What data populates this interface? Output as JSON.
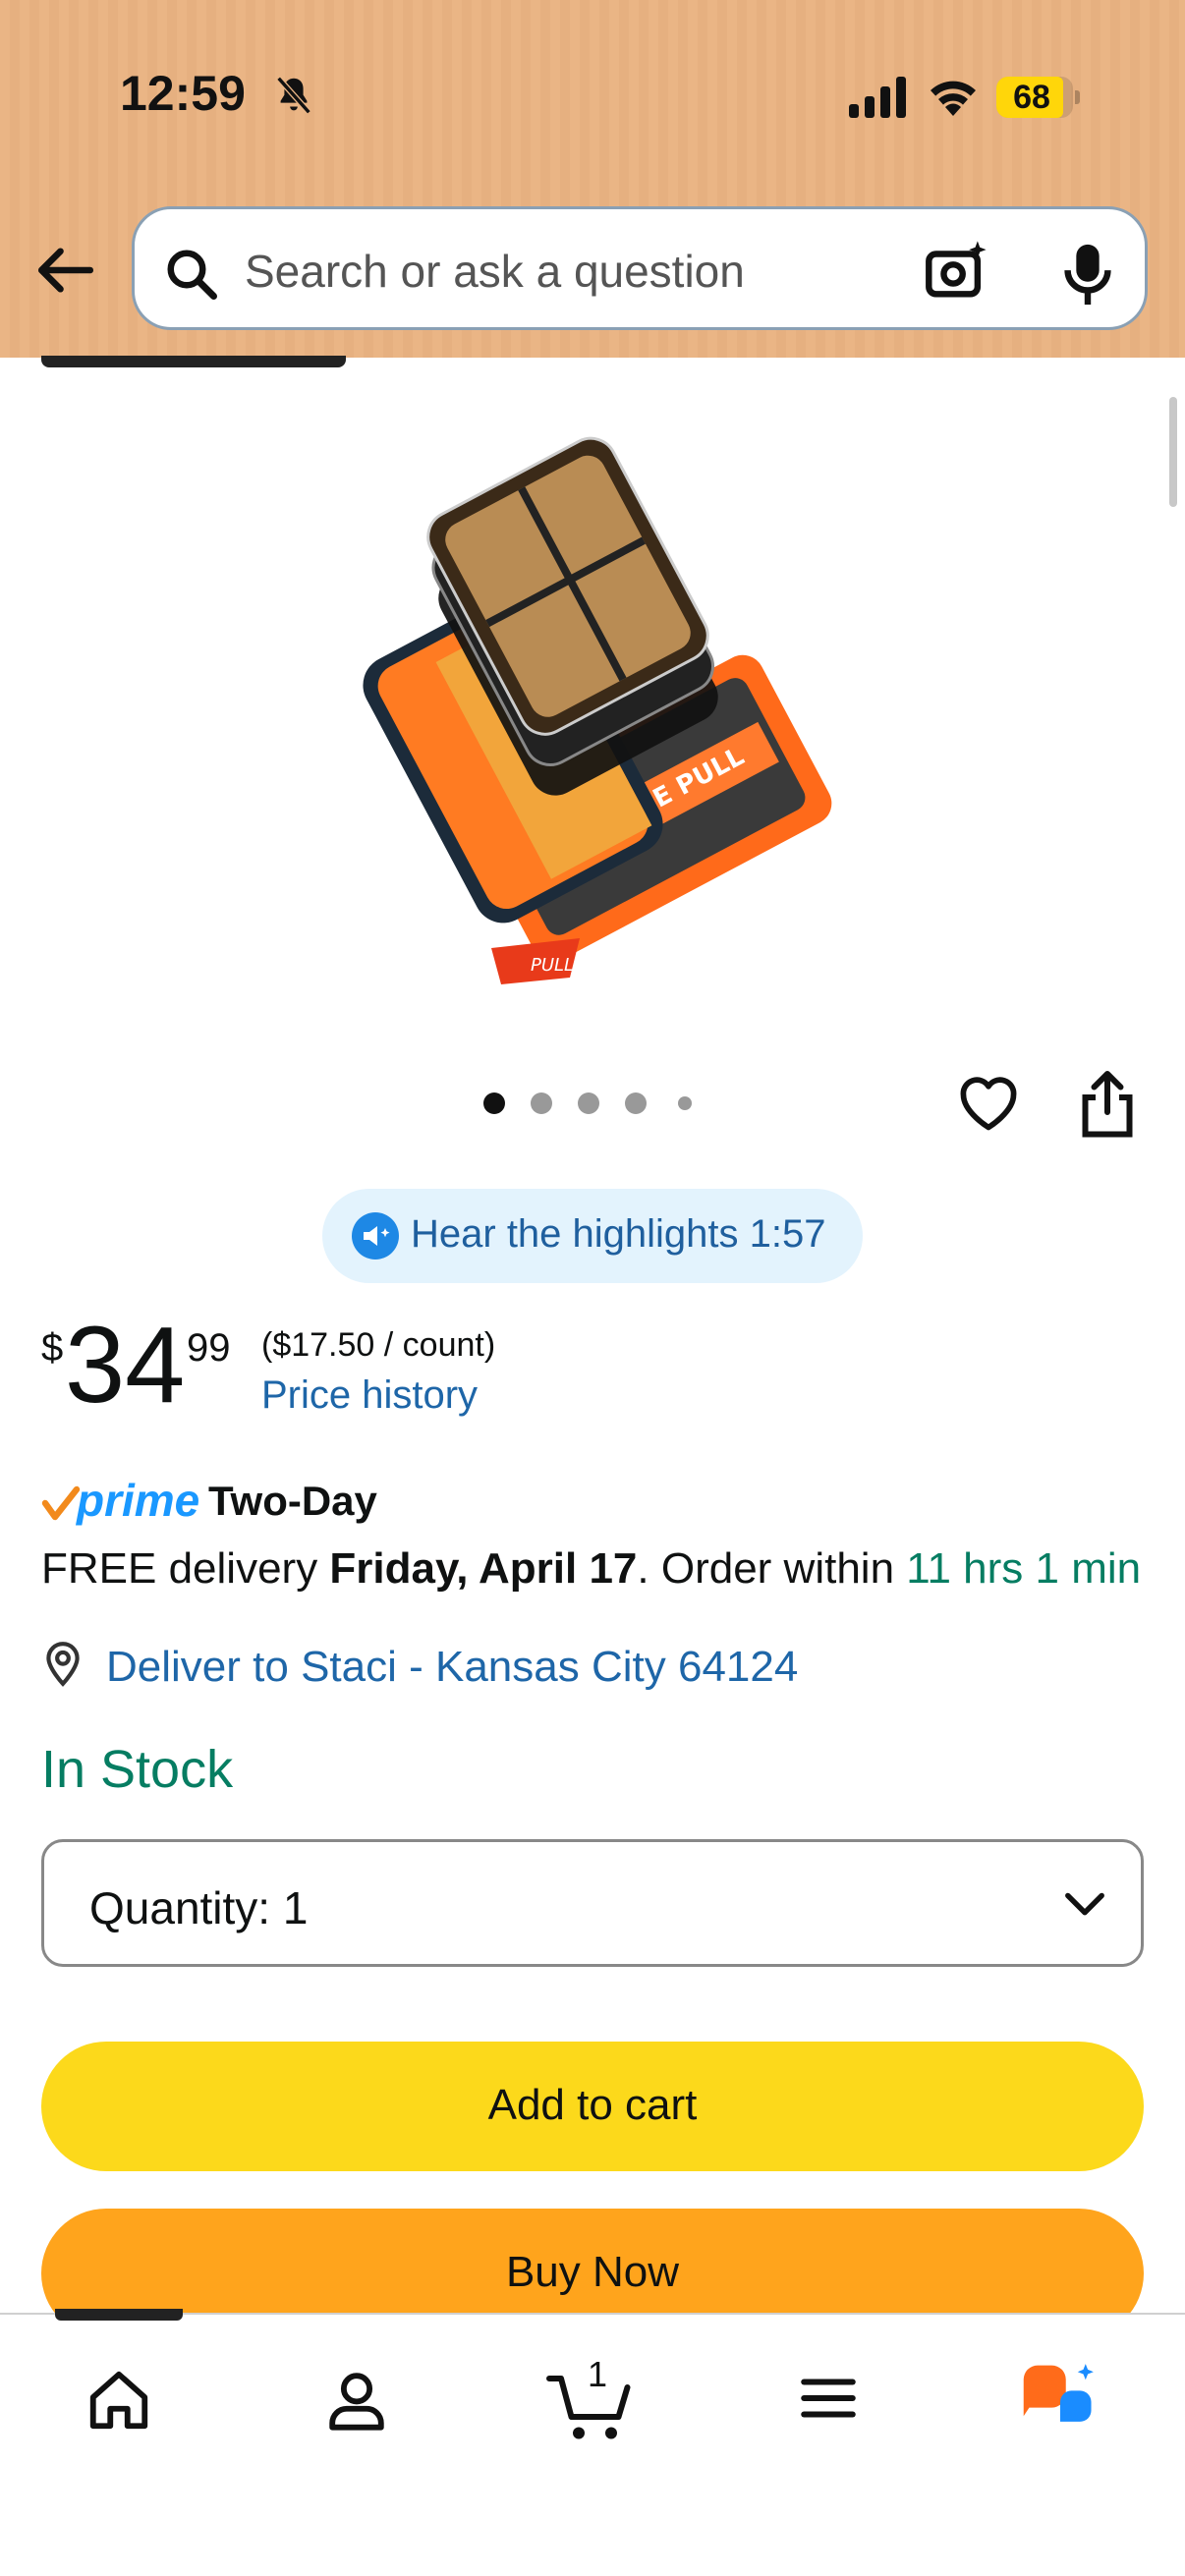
{
  "status_bar": {
    "time": "12:59",
    "battery": "68"
  },
  "header": {
    "search_placeholder": "Search or ask a question"
  },
  "product": {
    "image_dots_count": 5,
    "hear_highlights": "Hear the highlights 1:57",
    "price_symbol": "$",
    "price_whole": "34",
    "price_fraction": "99",
    "unit_price": "($17.50 / count)",
    "price_history": "Price history",
    "prime_word": "prime",
    "prime_speed": "Two-Day",
    "delivery_prefix": "FREE delivery ",
    "delivery_date": "Friday, April 17",
    "delivery_mid": ". Order within ",
    "delivery_countdown": "11 hrs 1 min",
    "deliver_to": "Deliver to Staci - Kansas City 64124",
    "stock_status": "In Stock",
    "quantity_label": "Quantity:  1",
    "add_to_cart": "Add to cart",
    "buy_now": "Buy Now"
  },
  "nav": {
    "cart_count": "1"
  },
  "colors": {
    "accent_blue": "#1e66a8",
    "green": "#067d62",
    "cart_yellow": "#fcd91b",
    "buy_orange": "#ffa41c"
  }
}
